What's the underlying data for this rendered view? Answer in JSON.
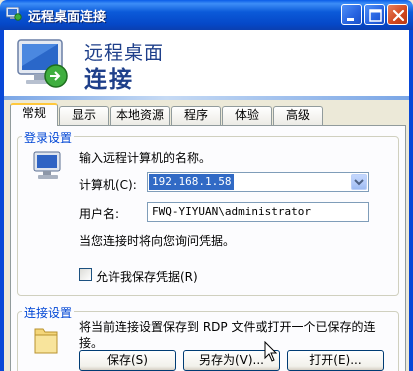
{
  "window": {
    "title": "远程桌面连接",
    "controls": {
      "minimize_icon": "minimize-icon",
      "maximize_icon": "maximize-icon",
      "close_icon": "close-icon"
    }
  },
  "banner": {
    "line1": "远程桌面",
    "line2": "连接"
  },
  "tabs": [
    "常规",
    "显示",
    "本地资源",
    "程序",
    "体验",
    "高级"
  ],
  "active_tab": "常规",
  "login_group": {
    "label": "登录设置",
    "instruction": "输入远程计算机的名称。",
    "computer_label": "计算机(C):",
    "computer_value": "192.168.1.58",
    "username_label": "用户名:",
    "username_value": "FWQ-YIYUAN\\administrator",
    "credentials_note": "当您连接时将向您询问凭据。",
    "save_credentials_label": "允许我保存凭据(R)",
    "save_credentials_checked": false
  },
  "connection_group": {
    "label": "连接设置",
    "description": "将当前连接设置保存到 RDP 文件或打开一个已保存的连接。",
    "save_button": "保存(S)",
    "save_as_button": "另存为(V)...",
    "open_button": "打开(E)..."
  },
  "colors": {
    "titlebar": "#0a5ce8",
    "group_label": "#0046d5",
    "banner_text": "#1e3f8a",
    "selection": "#316ac5",
    "active_tab_accent": "#ffc83c"
  }
}
